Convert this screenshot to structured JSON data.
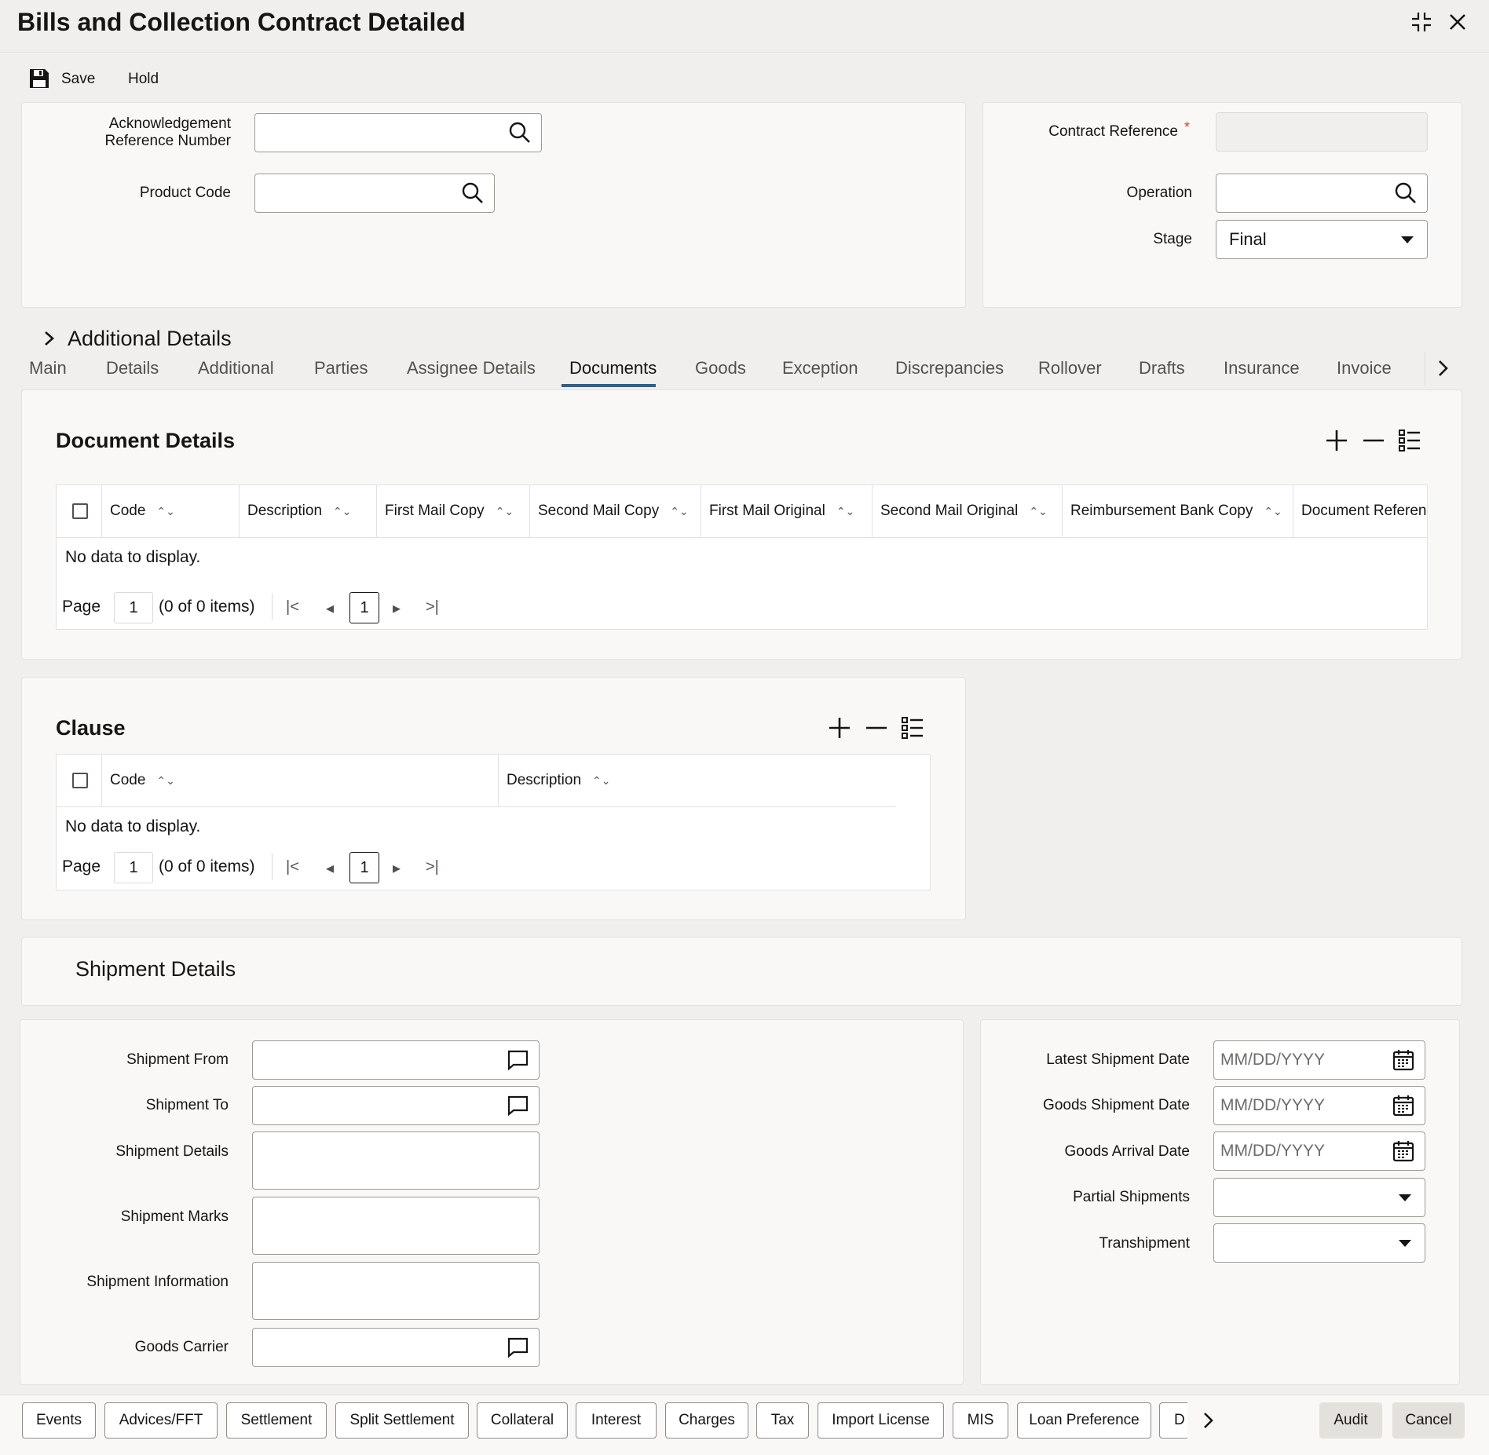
{
  "window": {
    "title": "Bills and Collection Contract Detailed"
  },
  "toolbar": {
    "save_label": "Save",
    "hold_label": "Hold"
  },
  "header": {
    "ack_ref_label": "Acknowledgement Reference Number",
    "ack_ref_value": "",
    "product_code_label": "Product Code",
    "product_code_value": "",
    "contract_ref_label": "Contract Reference",
    "contract_ref_required": "*",
    "contract_ref_value": "",
    "operation_label": "Operation",
    "operation_value": "",
    "stage_label": "Stage",
    "stage_value": "Final"
  },
  "additional_details": {
    "label": "Additional Details"
  },
  "tabs": [
    {
      "label": "Main"
    },
    {
      "label": "Details"
    },
    {
      "label": "Additional"
    },
    {
      "label": "Parties"
    },
    {
      "label": "Assignee Details"
    },
    {
      "label": "Documents",
      "active": true
    },
    {
      "label": "Goods"
    },
    {
      "label": "Exception"
    },
    {
      "label": "Discrepancies"
    },
    {
      "label": "Rollover"
    },
    {
      "label": "Drafts"
    },
    {
      "label": "Insurance"
    },
    {
      "label": "Invoice"
    }
  ],
  "documents": {
    "title": "Document Details",
    "columns": [
      "Code",
      "Description",
      "First Mail Copy",
      "Second Mail Copy",
      "First Mail Original",
      "Second Mail Original",
      "Reimbursement Bank Copy",
      "Document Referenc"
    ],
    "no_data": "No data to display.",
    "page_label": "Page",
    "page_value": "1",
    "items_text": "(0 of 0 items)",
    "current_page": "1"
  },
  "clause": {
    "title": "Clause",
    "columns": [
      "Code",
      "Description"
    ],
    "no_data": "No data to display.",
    "page_label": "Page",
    "page_value": "1",
    "items_text": "(0 of 0 items)",
    "current_page": "1"
  },
  "shipment": {
    "title": "Shipment Details",
    "shipment_from_label": "Shipment From",
    "shipment_to_label": "Shipment To",
    "shipment_details_label": "Shipment Details",
    "shipment_marks_label": "Shipment Marks",
    "shipment_information_label": "Shipment Information",
    "goods_carrier_label": "Goods Carrier",
    "latest_shipment_date_label": "Latest Shipment Date",
    "goods_shipment_date_label": "Goods Shipment Date",
    "goods_arrival_date_label": "Goods Arrival Date",
    "partial_shipments_label": "Partial Shipments",
    "transhipment_label": "Transhipment",
    "date_placeholder": "MM/DD/YYYY"
  },
  "footer_buttons": [
    "Events",
    "Advices/FFT",
    "Settlement",
    "Split Settlement",
    "Collateral",
    "Interest",
    "Charges",
    "Tax",
    "Import License",
    "MIS",
    "Loan Preference",
    "D"
  ],
  "footer_right": {
    "audit_label": "Audit",
    "cancel_label": "Cancel"
  }
}
